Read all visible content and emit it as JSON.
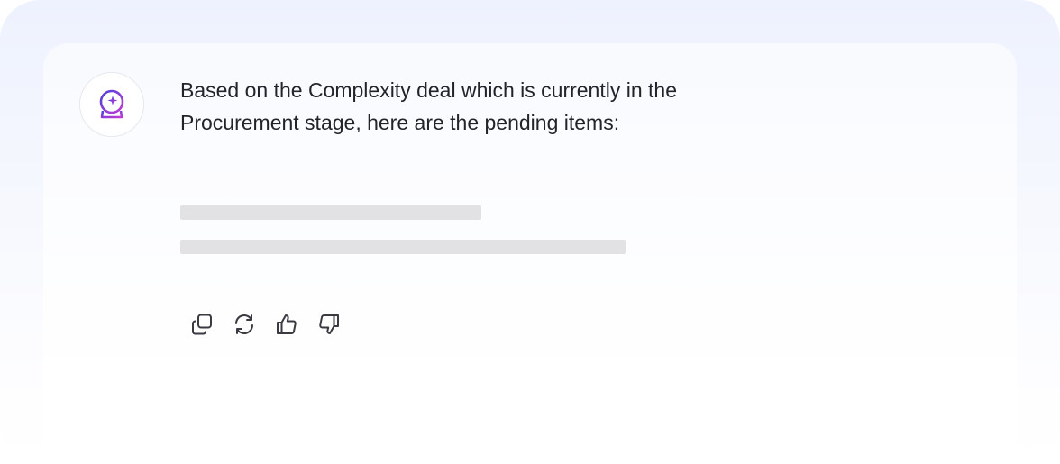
{
  "chat": {
    "assistant_message": "Based on the Complexity deal which is currently in the Procurement stage, here are the pending items:"
  },
  "icons": {
    "avatar": "crystal-ball-icon",
    "copy": "copy-icon",
    "regenerate": "refresh-icon",
    "like": "thumbs-up-icon",
    "dislike": "thumbs-down-icon"
  },
  "colors": {
    "avatar_gradient_start": "#5b3fd9",
    "avatar_gradient_end": "#c23bd4",
    "text": "#23242a",
    "icon": "#3a3b42",
    "skeleton": "#e2e2e4"
  }
}
